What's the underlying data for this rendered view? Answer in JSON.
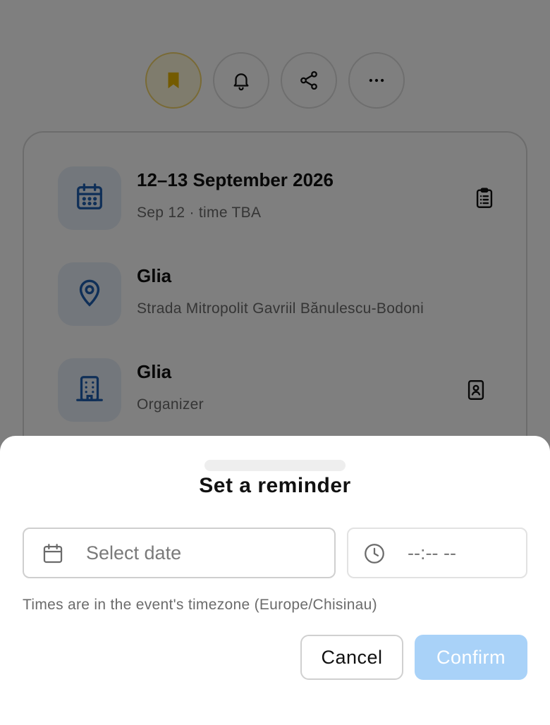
{
  "actions": [
    {
      "name": "bookmark",
      "icon": "bookmark-icon",
      "active": true
    },
    {
      "name": "reminder",
      "icon": "bell-icon"
    },
    {
      "name": "share",
      "icon": "share-icon"
    },
    {
      "name": "more",
      "icon": "more-horizontal-icon"
    }
  ],
  "event": {
    "date_title": "12–13 September 2026",
    "date_sub": "Sep 12 · time TBA",
    "venue_title": "Glia",
    "venue_sub": "Strada Mitropolit Gavriil Bănulescu-Bodoni",
    "organizer_title": "Glia",
    "organizer_sub": "Organizer"
  },
  "reminder": {
    "title": "Set a reminder",
    "date_placeholder": "Select date",
    "time_placeholder": "--:-- --",
    "timezone_note": "Times are in the event's timezone (Europe/Chisinau)",
    "cancel_label": "Cancel",
    "confirm_label": "Confirm"
  },
  "colors": {
    "accent_blue": "#1f5fb0",
    "tile_bg": "#e6eef8",
    "bookmark_yellow": "#e9b600",
    "confirm_disabled": "#a9d2f8"
  }
}
